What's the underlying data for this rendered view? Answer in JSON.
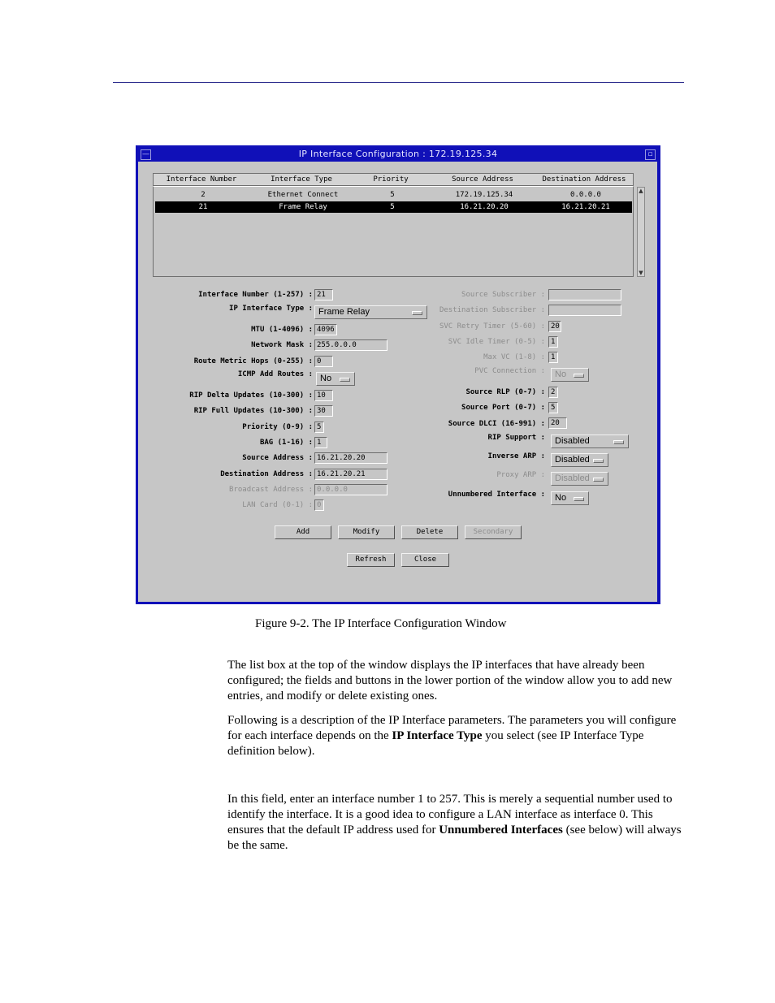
{
  "window": {
    "title": "IP Interface Configuration : 172.19.125.34",
    "menu_glyph": "—",
    "minimize_glyph": "▫"
  },
  "list": {
    "columns": [
      "Interface Number",
      "Interface Type",
      "Priority",
      "Source Address",
      "Destination Address"
    ],
    "rows": [
      {
        "number": "2",
        "type": "Ethernet Connect",
        "priority": "5",
        "source": "172.19.125.34",
        "destination": "0.0.0.0",
        "selected": false
      },
      {
        "number": "21",
        "type": "Frame Relay",
        "priority": "5",
        "source": "16.21.20.20",
        "destination": "16.21.20.21",
        "selected": true
      }
    ],
    "scroll_up": "▲",
    "scroll_down": "▼"
  },
  "form_left": [
    {
      "label": "Interface Number (1-257) :",
      "value": "21",
      "kind": "field",
      "enabled": true
    },
    {
      "label": "IP Interface Type :",
      "value": "Frame Relay",
      "kind": "option",
      "enabled": true
    },
    {
      "label": "MTU (1-4096) :",
      "value": "4096",
      "kind": "field",
      "enabled": true
    },
    {
      "label": "Network Mask :",
      "value": "255.0.0.0",
      "kind": "field",
      "enabled": true
    },
    {
      "label": "Route Metric Hops (0-255) :",
      "value": "0",
      "kind": "field",
      "enabled": true
    },
    {
      "label": "ICMP Add Routes :",
      "value": "No",
      "kind": "option",
      "enabled": true
    },
    {
      "label": "RIP Delta Updates (10-300) :",
      "value": "10",
      "kind": "field",
      "enabled": true
    },
    {
      "label": "RIP Full Updates (10-300) :",
      "value": "30",
      "kind": "field",
      "enabled": true
    },
    {
      "label": "Priority (0-9) :",
      "value": "5",
      "kind": "field",
      "enabled": true
    },
    {
      "label": "BAG (1-16) :",
      "value": "1",
      "kind": "field",
      "enabled": true
    },
    {
      "label": "Source Address :",
      "value": "16.21.20.20",
      "kind": "field",
      "enabled": true
    },
    {
      "label": "Destination Address :",
      "value": "16.21.20.21",
      "kind": "field",
      "enabled": true
    },
    {
      "label": "Broadcast Address :",
      "value": "0.0.0.0",
      "kind": "field",
      "enabled": false
    },
    {
      "label": "LAN Card (0-1) :",
      "value": "0",
      "kind": "field",
      "enabled": false
    }
  ],
  "form_right": [
    {
      "label": "Source Subscriber :",
      "value": "",
      "kind": "field",
      "enabled": false
    },
    {
      "label": "Destination Subscriber :",
      "value": "",
      "kind": "field",
      "enabled": false
    },
    {
      "label": "SVC Retry Timer (5-60) :",
      "value": "20",
      "kind": "field",
      "enabled": false
    },
    {
      "label": "SVC Idle Timer (0-5) :",
      "value": "1",
      "kind": "field",
      "enabled": false
    },
    {
      "label": "Max VC (1-8) :",
      "value": "1",
      "kind": "field",
      "enabled": false
    },
    {
      "label": "PVC Connection :",
      "value": "No",
      "kind": "option",
      "enabled": false
    },
    {
      "label": "Source RLP (0-7) :",
      "value": "2",
      "kind": "field",
      "enabled": true
    },
    {
      "label": "Source Port (0-7) :",
      "value": "5",
      "kind": "field",
      "enabled": true
    },
    {
      "label": "Source DLCI (16-991) :",
      "value": "20",
      "kind": "field",
      "enabled": true
    },
    {
      "label": "RIP Support :",
      "value": "Disabled",
      "kind": "option",
      "enabled": true
    },
    {
      "label": "Inverse ARP :",
      "value": "Disabled",
      "kind": "option",
      "enabled": true
    },
    {
      "label": "Proxy ARP :",
      "value": "Disabled",
      "kind": "option",
      "enabled": false
    },
    {
      "label": "Unnumbered Interface :",
      "value": "No",
      "kind": "option",
      "enabled": true
    }
  ],
  "buttons": {
    "add": "Add",
    "modify": "Modify",
    "delete": "Delete",
    "secondary": "Secondary",
    "refresh": "Refresh",
    "close": "Close"
  },
  "caption": "Figure 9-2.  The IP Interface Configuration Window",
  "paragraphs": {
    "p1": "The list box at the top of the window displays the IP interfaces that have already been configured; the fields and buttons in the lower portion of the window allow you to add new entries, and modify or delete existing ones.",
    "p2_before": "Following is a description of the IP Interface parameters. The parameters you will configure for each interface depends on the ",
    "p2_bold": "IP Interface Type",
    "p2_after": " you select (see IP Interface Type definition below).",
    "p3_before": "In this field, enter an interface number 1 to 257. This is merely a sequential number used to identify the interface. It is a good idea to configure a LAN interface as interface 0. This ensures that the default IP address used for ",
    "p3_bold": "Unnumbered Interfaces",
    "p3_after": " (see below) will always be the same."
  }
}
